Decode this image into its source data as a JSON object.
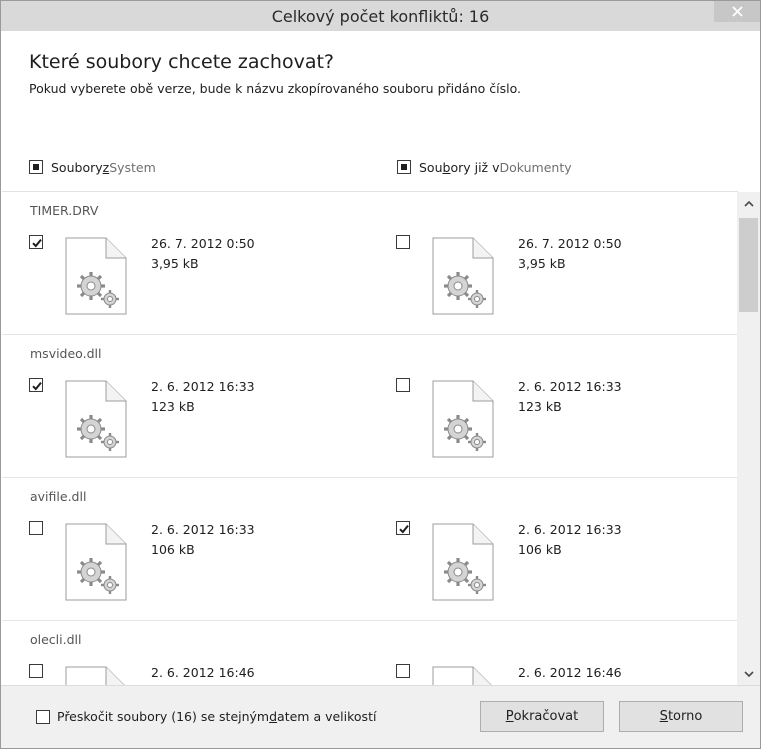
{
  "window": {
    "title": "Celkový počet konfliktů: 16",
    "close_glyph": "×"
  },
  "header": {
    "question": "Které soubory chcete zachovat?",
    "subtitle": "Pokud vyberete obě verze, bude k názvu zkopírovaného souboru přidáno číslo."
  },
  "columns": {
    "left": {
      "pre": "Soubory ",
      "key": "z",
      "post": " ",
      "location": "System"
    },
    "right": {
      "pre": "Sou",
      "key": "b",
      "post": "ory již v ",
      "location": "Dokumenty"
    }
  },
  "files": [
    {
      "name": "TIMER.DRV",
      "left": {
        "date": "26. 7. 2012 0:50",
        "size": "3,95 kB",
        "checked": true
      },
      "right": {
        "date": "26. 7. 2012 0:50",
        "size": "3,95 kB",
        "checked": false
      }
    },
    {
      "name": "msvideo.dll",
      "left": {
        "date": "2. 6. 2012 16:33",
        "size": "123 kB",
        "checked": true
      },
      "right": {
        "date": "2. 6. 2012 16:33",
        "size": "123 kB",
        "checked": false
      }
    },
    {
      "name": "avifile.dll",
      "left": {
        "date": "2. 6. 2012 16:33",
        "size": "106 kB",
        "checked": false
      },
      "right": {
        "date": "2. 6. 2012 16:33",
        "size": "106 kB",
        "checked": true
      }
    },
    {
      "name": "olecli.dll",
      "left": {
        "date": "2. 6. 2012 16:46",
        "size": "",
        "checked": false
      },
      "right": {
        "date": "2. 6. 2012 16:46",
        "size": "",
        "checked": false
      }
    }
  ],
  "footer": {
    "skip": {
      "pre": "Přeskočit soubory (16) se stejným ",
      "key": "d",
      "post": "atem a velikostí"
    },
    "continue": {
      "key": "P",
      "rest": "okračovat"
    },
    "cancel": {
      "key": "S",
      "rest": "torno"
    }
  },
  "icons": {
    "file": "settings-file-icon",
    "check": "checkmark-icon",
    "close": "close-icon"
  },
  "colors": {
    "titlebar": "#d9d9d9",
    "footer": "#f0f0f0",
    "scroll_thumb": "#cdcdcd"
  }
}
